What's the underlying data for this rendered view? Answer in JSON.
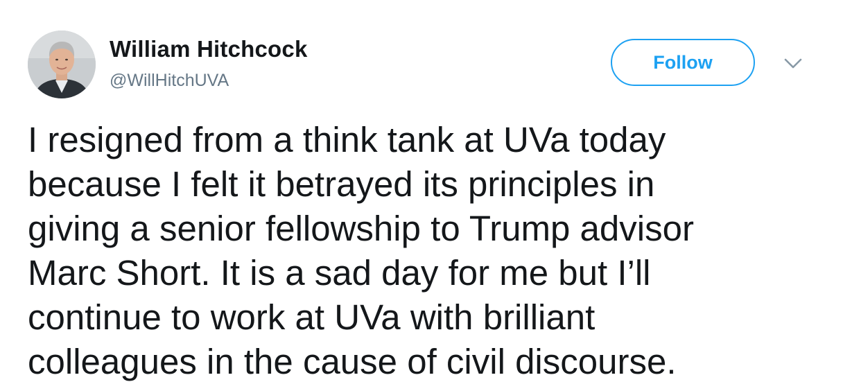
{
  "author": {
    "name": "William Hitchcock",
    "handle": "@WillHitchUVA",
    "avatar_icon": "profile-photo"
  },
  "actions": {
    "follow_label": "Follow",
    "menu_icon": "chevron-down-icon"
  },
  "tweet": {
    "lines": [
      "I resigned from a think tank at UVa today",
      "because I felt it betrayed its principles in",
      "giving a senior fellowship to Trump advisor",
      "Marc Short. It is a sad day for me but I’ll",
      "continue to work at UVa with brilliant",
      "colleagues in the cause of civil discourse."
    ]
  },
  "colors": {
    "accent": "#1da1f2",
    "text": "#14171a",
    "muted": "#657786",
    "background": "#ffffff"
  }
}
